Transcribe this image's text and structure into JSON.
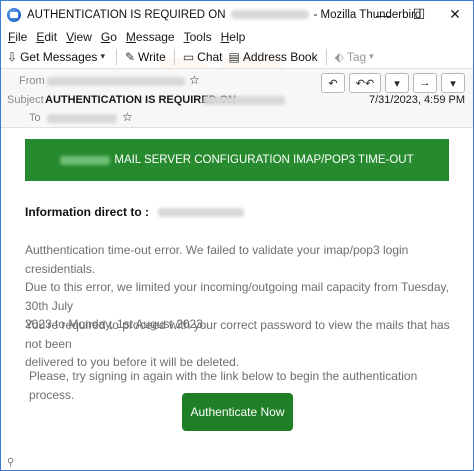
{
  "window": {
    "title_prefix": "AUTHENTICATION IS REQUIRED ON",
    "title_suffix": "- Mozilla Thunderbird",
    "minimize": "—",
    "maximize": "☐",
    "close": "✕"
  },
  "menu": [
    "File",
    "Edit",
    "View",
    "Go",
    "Message",
    "Tools",
    "Help"
  ],
  "toolbar": {
    "get_messages": "Get Messages",
    "write": "Write",
    "chat": "Chat",
    "address_book": "Address Book",
    "tag": "Tag"
  },
  "header": {
    "from_label": "From",
    "subject_label": "Subject",
    "subject_value": "AUTHENTICATION IS REQUIRED ON",
    "to_label": "To",
    "date": "7/31/2023, 4:59 PM"
  },
  "message": {
    "banner_text": "MAIL SERVER CONFIGURATION IMAP/POP3 TIME-OUT",
    "info_label": "Information direct to :",
    "para1_line1": "Autthentication time-out error. We failed to validate your imap/pop3 login cresidentials.",
    "para1_line2": "Due to this error, we limited your incoming/outgoing mail capacity from Tuesday, 30th July",
    "para1_line3": "2023 to Monday, 1st August 2023.",
    "para2_line1": "You're required to proceed with your correct password to view the mails that has not been",
    "para2_line2": "delivered to you before it will be deleted.",
    "para3": "Please, try signing in again with the link below to begin the authentication process.",
    "button_label": "Authenticate Now"
  },
  "colors": {
    "banner_bg": "#278a2f",
    "button_bg": "#1f7f26",
    "window_border": "#3b7bd6"
  }
}
